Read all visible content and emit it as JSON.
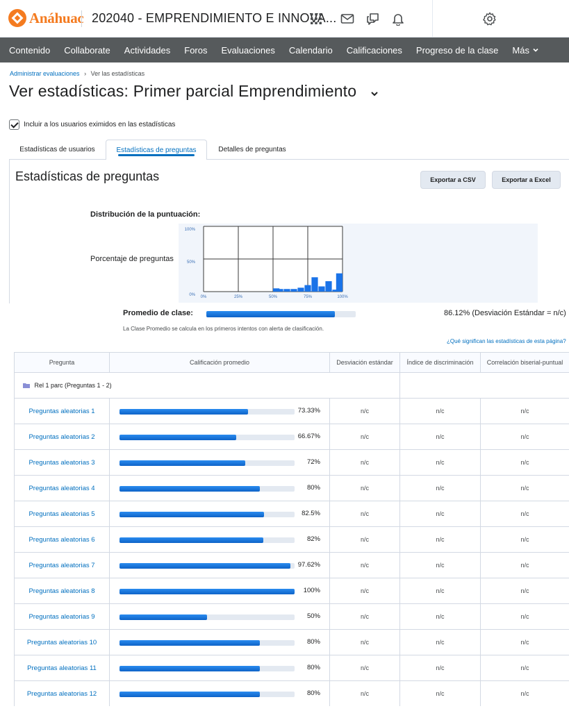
{
  "header": {
    "logo_text": "Anáhuac",
    "course_title": "202040 - EMPRENDIMIENTO E INNOVA...",
    "icons": [
      "apps-grid-icon",
      "mail-icon",
      "chat-icon",
      "bell-icon",
      "gear-icon"
    ]
  },
  "nav": {
    "items": [
      "Contenido",
      "Collaborate",
      "Actividades",
      "Foros",
      "Evaluaciones",
      "Calendario",
      "Calificaciones",
      "Progreso de la clase",
      "Más"
    ]
  },
  "breadcrumb": {
    "parent": "Administrar evaluaciones",
    "separator": "›",
    "current": "Ver las estadísticas"
  },
  "page_title": "Ver estadísticas: Primer parcial Emprendimiento",
  "include_exempt": {
    "label": "Incluir a los usuarios eximidos en las estadísticas",
    "checked": true
  },
  "tabs": [
    {
      "label": "Estadísticas de usuarios",
      "active": false
    },
    {
      "label": "Estadísticas de preguntas",
      "active": true
    },
    {
      "label": "Detalles de preguntas",
      "active": false
    }
  ],
  "panel": {
    "title": "Estadísticas de preguntas",
    "export_csv": "Exportar a CSV",
    "export_excel": "Exportar a Excel"
  },
  "distribution": {
    "label": "Distribución de la puntuación:",
    "y_label": "Porcentaje de preguntas"
  },
  "chart_data": {
    "type": "bar",
    "y_ticks": [
      "100%",
      "50%",
      "0%"
    ],
    "x_ticks": [
      "0%",
      "25%",
      "50%",
      "75%",
      "100%"
    ],
    "xlim": [
      0,
      100
    ],
    "ylim": [
      0,
      100
    ],
    "grid": true,
    "bins": [
      {
        "x": 50,
        "value": 5
      },
      {
        "x": 55,
        "value": 4
      },
      {
        "x": 60,
        "value": 4
      },
      {
        "x": 65,
        "value": 4
      },
      {
        "x": 70,
        "value": 6
      },
      {
        "x": 75,
        "value": 10
      },
      {
        "x": 80,
        "value": 22
      },
      {
        "x": 85,
        "value": 8
      },
      {
        "x": 90,
        "value": 16
      },
      {
        "x": 95,
        "value": 3
      },
      {
        "x": 100,
        "value": 28
      }
    ]
  },
  "class_average": {
    "label": "Promedio de clase:",
    "value": 86.12,
    "text": "86.12% (Desviación Estándar = n/c)",
    "note": "La Clase Promedio se calcula en los primeros intentos con alerta de clasificación.",
    "help_link": "¿Qué significan las estadísticas de esta página?"
  },
  "table": {
    "headers": [
      "Pregunta",
      "Calificación promedio",
      "Desviación estándar",
      "Índice de discriminación",
      "Correlación biserial-puntual"
    ],
    "section_label": "Rel 1 parc (Preguntas 1 - 2)",
    "rows": [
      {
        "name": "Preguntas aleatorias 1",
        "value": 73.33,
        "label": "73.33%",
        "sd": "n/c",
        "di": "n/c",
        "pb": "n/c"
      },
      {
        "name": "Preguntas aleatorias 2",
        "value": 66.67,
        "label": "66.67%",
        "sd": "n/c",
        "di": "n/c",
        "pb": "n/c"
      },
      {
        "name": "Preguntas aleatorias 3",
        "value": 72,
        "label": "72%",
        "sd": "n/c",
        "di": "n/c",
        "pb": "n/c"
      },
      {
        "name": "Preguntas aleatorias 4",
        "value": 80,
        "label": "80%",
        "sd": "n/c",
        "di": "n/c",
        "pb": "n/c"
      },
      {
        "name": "Preguntas aleatorias 5",
        "value": 82.5,
        "label": "82.5%",
        "sd": "n/c",
        "di": "n/c",
        "pb": "n/c"
      },
      {
        "name": "Preguntas aleatorias 6",
        "value": 82,
        "label": "82%",
        "sd": "n/c",
        "di": "n/c",
        "pb": "n/c"
      },
      {
        "name": "Preguntas aleatorias 7",
        "value": 97.62,
        "label": "97.62%",
        "sd": "n/c",
        "di": "n/c",
        "pb": "n/c"
      },
      {
        "name": "Preguntas aleatorias 8",
        "value": 100,
        "label": "100%",
        "sd": "n/c",
        "di": "n/c",
        "pb": "n/c"
      },
      {
        "name": "Preguntas aleatorias 9",
        "value": 50,
        "label": "50%",
        "sd": "n/c",
        "di": "n/c",
        "pb": "n/c"
      },
      {
        "name": "Preguntas aleatorias 10",
        "value": 80,
        "label": "80%",
        "sd": "n/c",
        "di": "n/c",
        "pb": "n/c"
      },
      {
        "name": "Preguntas aleatorias 11",
        "value": 80,
        "label": "80%",
        "sd": "n/c",
        "di": "n/c",
        "pb": "n/c"
      },
      {
        "name": "Preguntas aleatorias 12",
        "value": 80,
        "label": "80%",
        "sd": "n/c",
        "di": "n/c",
        "pb": "n/c"
      }
    ]
  },
  "colors": {
    "brand": "#f47b20",
    "nav_bg": "#565a5c",
    "link": "#006fbf",
    "bar": "#1a73e8",
    "track": "#e3e9f1"
  }
}
